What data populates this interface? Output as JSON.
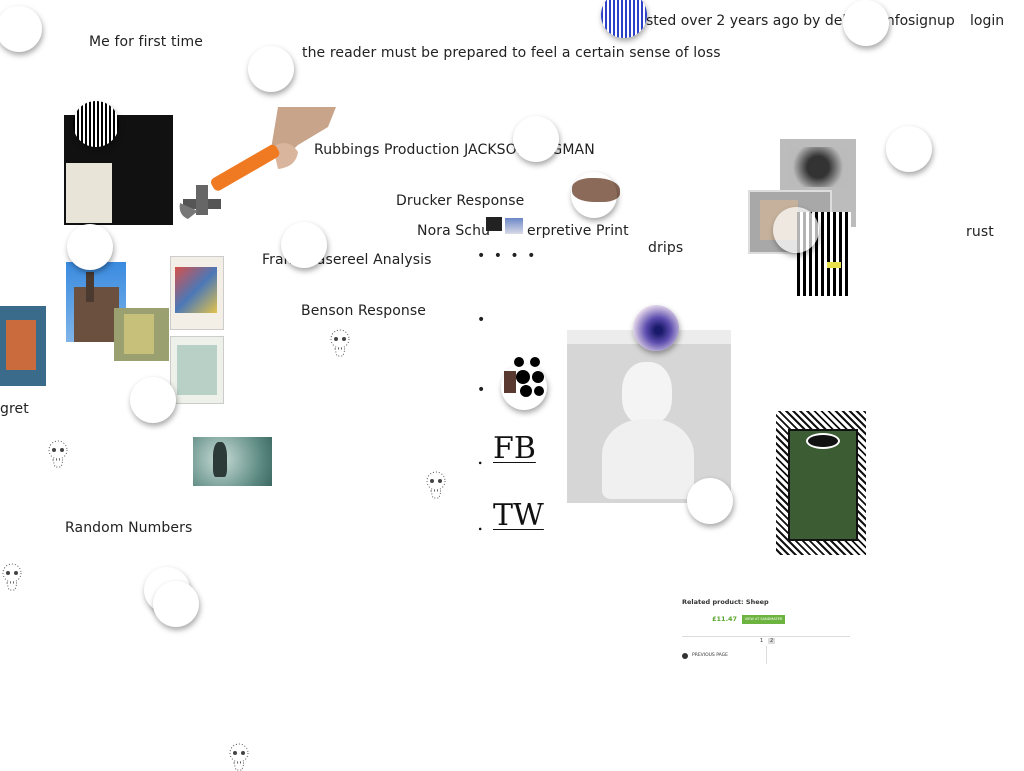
{
  "header": {
    "posted_text": "sted over 2 years ago by delinearinfo",
    "signup": "signup",
    "login": "login"
  },
  "posts": [
    {
      "id": "me-first-time",
      "label": "Me for first time"
    },
    {
      "id": "reader-loss",
      "label": "the reader must be prepared to feel a certain sense of loss"
    },
    {
      "id": "rubbings",
      "label": "Rubbings Production JACKSON ENGMAN"
    },
    {
      "id": "drucker",
      "label": "Drucker Response"
    },
    {
      "id": "nora",
      "label": "Nora Schu"
    },
    {
      "id": "nora-tail",
      "label": "erpretive Print"
    },
    {
      "id": "frans",
      "label": "Frans Masereel Analysis"
    },
    {
      "id": "benson",
      "label": "Benson Response"
    },
    {
      "id": "drips",
      "label": "drips"
    },
    {
      "id": "rust",
      "label": "rust"
    },
    {
      "id": "regret",
      "label": "gret"
    },
    {
      "id": "random",
      "label": "Random Numbers"
    }
  ],
  "social": {
    "dots": "• • • •",
    "fb": "FB",
    "tw": "TW"
  },
  "product_card": {
    "title": "Related product: Sheep",
    "price": "£11.47",
    "buy": "VIEW AT SANDMATER",
    "pages": [
      "1",
      "2"
    ],
    "prev": "PREVIOUS PAGE"
  },
  "colors": {
    "hammer_handle": "#f07a22",
    "price_green": "#5aa52e",
    "button_green": "#6cb33f"
  }
}
